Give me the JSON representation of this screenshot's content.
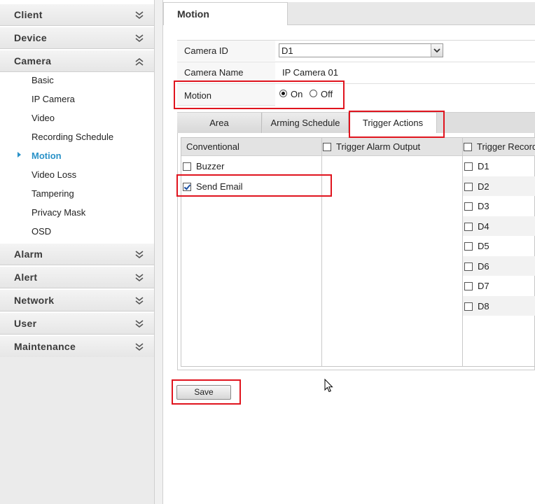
{
  "sidebar": {
    "sections": [
      {
        "label": "Client"
      },
      {
        "label": "Device"
      },
      {
        "label": "Camera"
      },
      {
        "label": "Alarm"
      },
      {
        "label": "Alert"
      },
      {
        "label": "Network"
      },
      {
        "label": "User"
      },
      {
        "label": "Maintenance"
      }
    ],
    "camera_items": [
      {
        "label": "Basic"
      },
      {
        "label": "IP Camera"
      },
      {
        "label": "Video"
      },
      {
        "label": "Recording Schedule"
      },
      {
        "label": "Motion",
        "active": true
      },
      {
        "label": "Video Loss"
      },
      {
        "label": "Tampering"
      },
      {
        "label": "Privacy Mask"
      },
      {
        "label": "OSD"
      }
    ]
  },
  "page": {
    "title": "Motion"
  },
  "form": {
    "camera_id_label": "Camera ID",
    "camera_id_value": "D1",
    "camera_name_label": "Camera Name",
    "camera_name_value": "IP Camera 01",
    "motion_label": "Motion",
    "motion_on": "On",
    "motion_off": "Off",
    "motion_selected": "On"
  },
  "tabs": [
    {
      "label": "Area"
    },
    {
      "label": "Arming Schedule"
    },
    {
      "label": "Trigger Actions",
      "active": true
    }
  ],
  "trigger": {
    "conventional_header": "Conventional",
    "alarm_output_header": "Trigger Alarm Output",
    "record_header": "Trigger Recording",
    "conventional_items": [
      {
        "label": "Buzzer",
        "checked": false
      },
      {
        "label": "Send Email",
        "checked": true
      }
    ],
    "record_channels": [
      "D1",
      "D2",
      "D3",
      "D4",
      "D5",
      "D6",
      "D7",
      "D8"
    ]
  },
  "actions": {
    "save_label": "Save"
  },
  "colors": {
    "accent": "#2a92c8",
    "highlight": "#e0141e"
  }
}
